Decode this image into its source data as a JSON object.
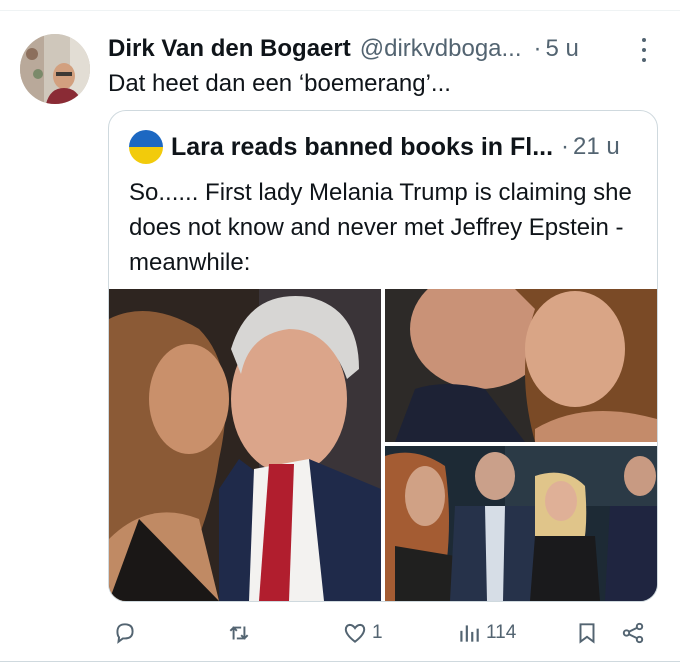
{
  "tweet": {
    "author_name": "Dirk Van den Bogaert",
    "author_handle": "@dirkvdboga...",
    "separator": "·",
    "time": "5 u",
    "text": "Dat heet dan een ‘boemerang’..."
  },
  "quoted_tweet": {
    "author_name": "Lara reads banned books in Fl...",
    "separator": "·",
    "time": "21 u",
    "text": "So...... First lady Melania Trump is claiming she does not know and never met Jeffrey Epstein - meanwhile:",
    "images": [
      {
        "icon": "photo-kiss"
      },
      {
        "icon": "photo-closeup"
      },
      {
        "icon": "photo-group"
      }
    ]
  },
  "actions": {
    "reply": {
      "icon": "reply-icon",
      "count": ""
    },
    "repost": {
      "icon": "repost-icon",
      "count": ""
    },
    "like": {
      "icon": "heart-icon",
      "count": "1"
    },
    "views": {
      "icon": "views-icon",
      "count": "114"
    },
    "bookmark": {
      "icon": "bookmark-icon",
      "count": ""
    },
    "share": {
      "icon": "share-icon",
      "count": ""
    }
  },
  "colors": {
    "text": "#0f1419",
    "muted": "#536471",
    "border": "#cfd9de",
    "flag_blue": "#1d68c2",
    "flag_yellow": "#f2cb0b"
  }
}
